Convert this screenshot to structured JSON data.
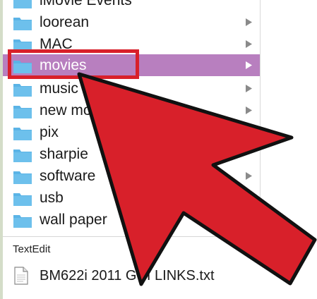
{
  "finder": {
    "items": [
      {
        "label": "iMovie Events",
        "selected": false,
        "has_children": false
      },
      {
        "label": "loorean",
        "selected": false,
        "has_children": true
      },
      {
        "label": "MAC",
        "selected": false,
        "has_children": true
      },
      {
        "label": "movies",
        "selected": true,
        "has_children": true
      },
      {
        "label": "music",
        "selected": false,
        "has_children": true
      },
      {
        "label": "new mo",
        "selected": false,
        "has_children": true
      },
      {
        "label": "pix",
        "selected": false,
        "has_children": false
      },
      {
        "label": "sharpie",
        "selected": false,
        "has_children": false
      },
      {
        "label": "software",
        "selected": false,
        "has_children": true
      },
      {
        "label": "usb",
        "selected": false,
        "has_children": false
      },
      {
        "label": "wall paper",
        "selected": false,
        "has_children": false
      }
    ],
    "section_header": "TextEdit",
    "file": {
      "label": "BM622i 2011 GUI LINKS.txt",
      "icon": "text-document-icon"
    }
  },
  "colors": {
    "folder": "#5bb4e6",
    "folder_tab": "#4aa3d8",
    "selection": "#b87fbf",
    "highlight_box": "#d8202a",
    "pointer": "#d8202a",
    "pointer_outline": "#111111"
  },
  "icons": {
    "folder": "folder-icon",
    "disclosure": "disclosure-arrow-icon",
    "pointer": "cursor-arrow-icon"
  }
}
